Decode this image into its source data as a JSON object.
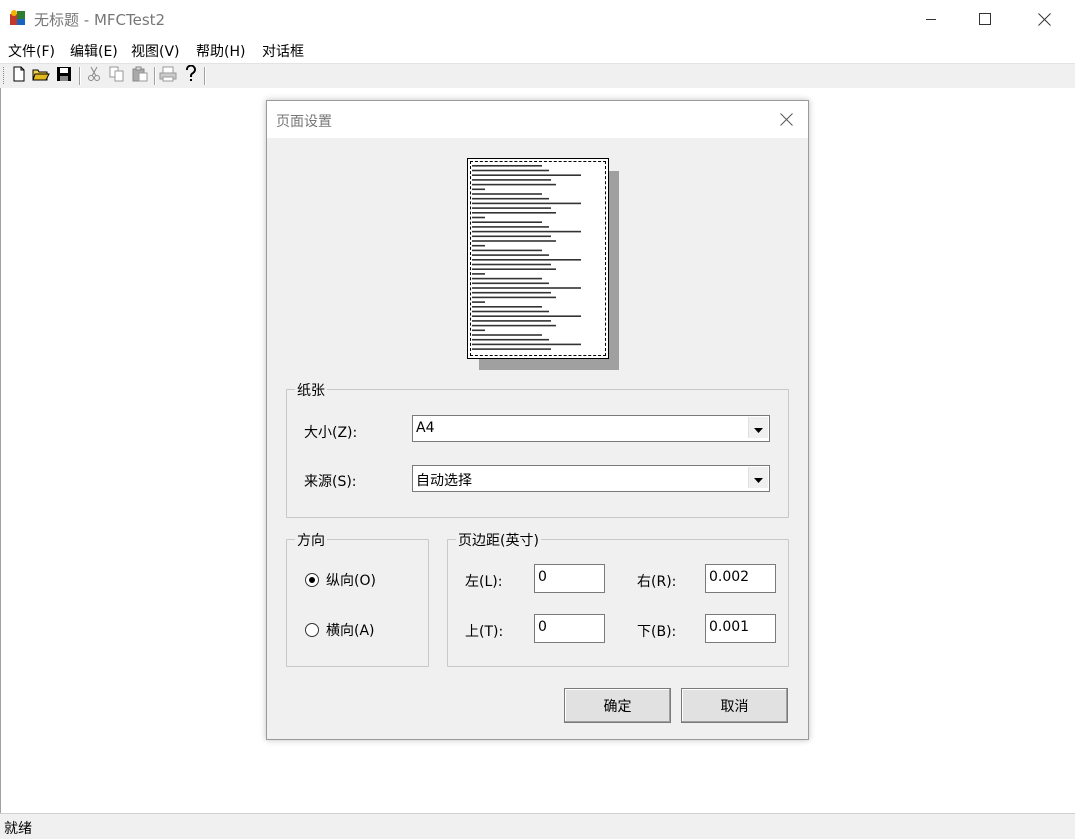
{
  "window": {
    "title": "无标题 - MFCTest2",
    "min_icon": "minimize-icon",
    "max_icon": "maximize-icon",
    "close_icon": "close-icon"
  },
  "menu": {
    "items": [
      {
        "label": "文件(F)"
      },
      {
        "label": "编辑(E)"
      },
      {
        "label": "视图(V)"
      },
      {
        "label": "帮助(H)"
      },
      {
        "label": "对话框"
      }
    ]
  },
  "toolbar": {
    "icons": [
      "new-file-icon",
      "open-folder-icon",
      "save-icon",
      "cut-icon",
      "copy-icon",
      "paste-icon",
      "print-icon",
      "help-icon"
    ]
  },
  "status": {
    "text": "就绪"
  },
  "dialog": {
    "title": "页面设置",
    "paper_group": "纸张",
    "size_label": "大小(Z):",
    "size_value": "A4",
    "source_label": "来源(S):",
    "source_value": "自动选择",
    "orientation_group": "方向",
    "portrait_label": "纵向(O)",
    "landscape_label": "横向(A)",
    "orientation_selected": "portrait",
    "margins_group": "页边距(英寸)",
    "left_label": "左(L):",
    "left_value": "0",
    "right_label": "右(R):",
    "right_value": "0.002",
    "top_label": "上(T):",
    "top_value": "0",
    "bottom_label": "下(B):",
    "bottom_value": "0.001",
    "ok_label": "确定",
    "cancel_label": "取消"
  },
  "colors": {
    "dialog_bg": "#f0f0f0",
    "border": "#7a7a7a",
    "preview_shadow": "#a0a0a0"
  }
}
